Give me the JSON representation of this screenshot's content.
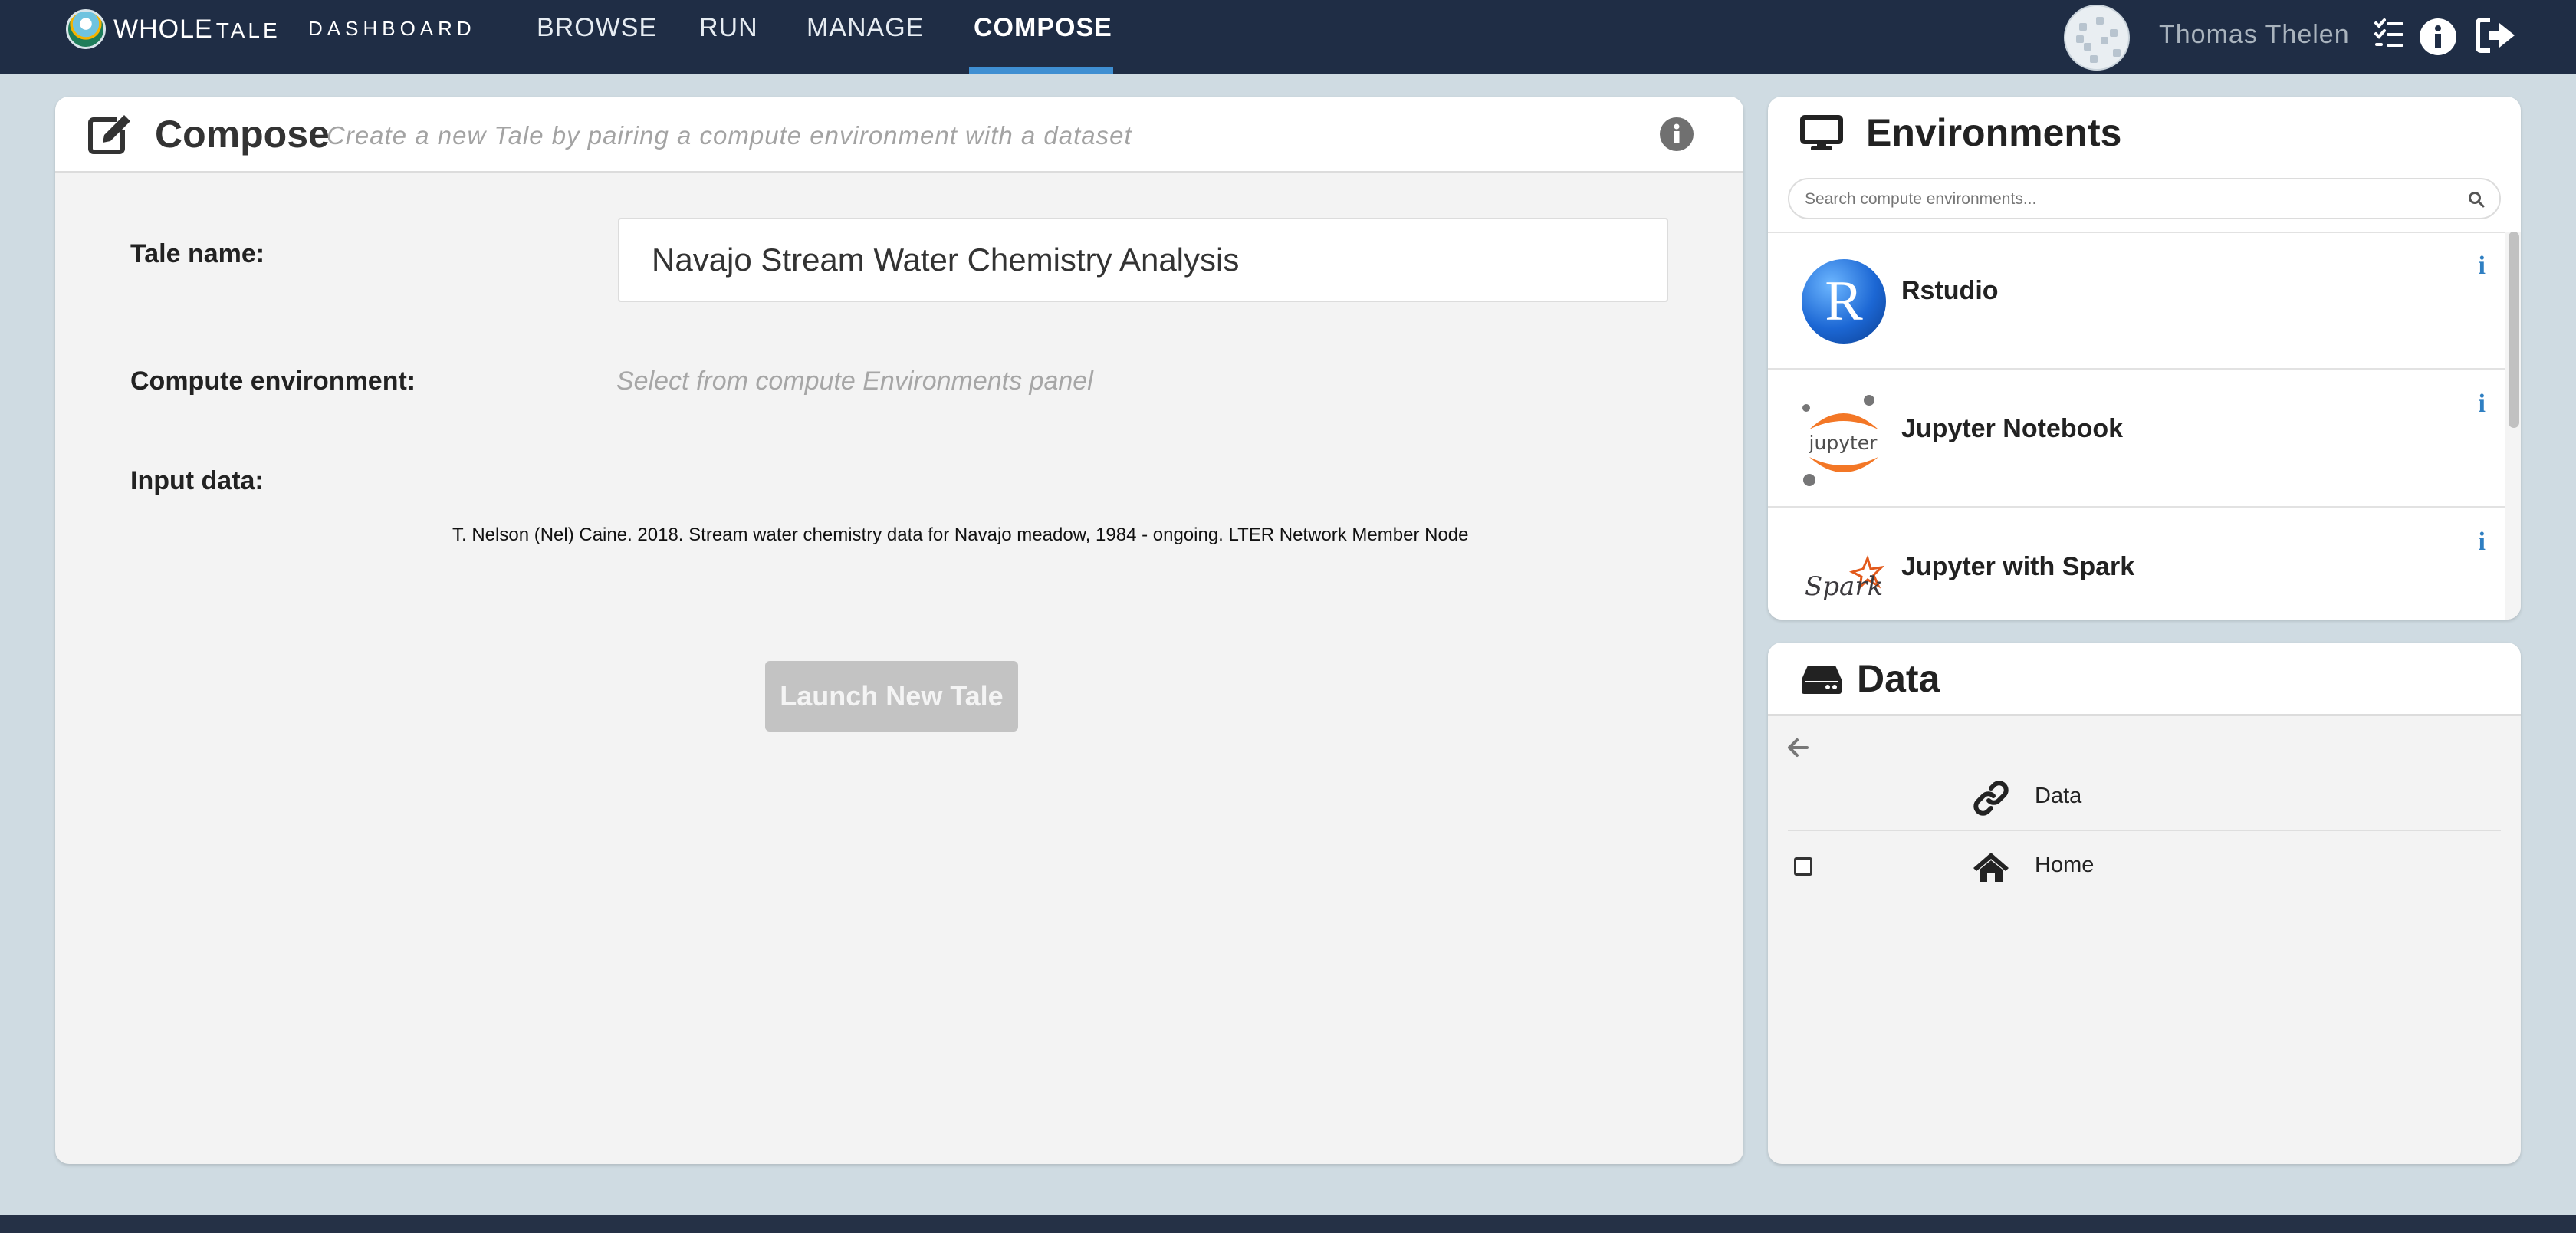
{
  "header": {
    "logo_whole": "WHOLE",
    "logo_tale": "TALE",
    "section": "DASHBOARD",
    "nav": [
      {
        "label": "BROWSE"
      },
      {
        "label": "RUN"
      },
      {
        "label": "MANAGE"
      },
      {
        "label": "COMPOSE",
        "active": true
      }
    ],
    "user_name": "Thomas Thelen",
    "icons": [
      "tasks-icon",
      "info-icon",
      "logout-icon"
    ]
  },
  "compose": {
    "title": "Compose",
    "subtitle": "Create a new Tale by pairing a compute environment with a dataset",
    "tale_name_label": "Tale name:",
    "tale_name_value": "Navajo Stream Water Chemistry Analysis",
    "compute_env_label": "Compute environment:",
    "compute_env_placeholder": "Select from compute Environments panel",
    "input_data_label": "Input data:",
    "input_data_value": "T. Nelson (Nel) Caine. 2018. Stream water chemistry data for Navajo meadow, 1984 - ongoing. LTER Network Member Node",
    "launch_button": "Launch New Tale"
  },
  "environments": {
    "title": "Environments",
    "search_placeholder": "Search compute environments...",
    "items": [
      {
        "name": "Rstudio",
        "icon": "rstudio-logo"
      },
      {
        "name": "Jupyter Notebook",
        "icon": "jupyter-logo"
      },
      {
        "name": "Jupyter with Spark",
        "icon": "spark-logo"
      }
    ]
  },
  "data_panel": {
    "title": "Data",
    "rows": [
      {
        "label": "Data",
        "icon": "link-icon"
      },
      {
        "label": "Home",
        "icon": "home-icon"
      }
    ]
  },
  "colors": {
    "navbar": "#1f2d45",
    "accent": "#3f8fd2",
    "background": "#cfdbe2",
    "info_blue": "#2f7fc2"
  }
}
